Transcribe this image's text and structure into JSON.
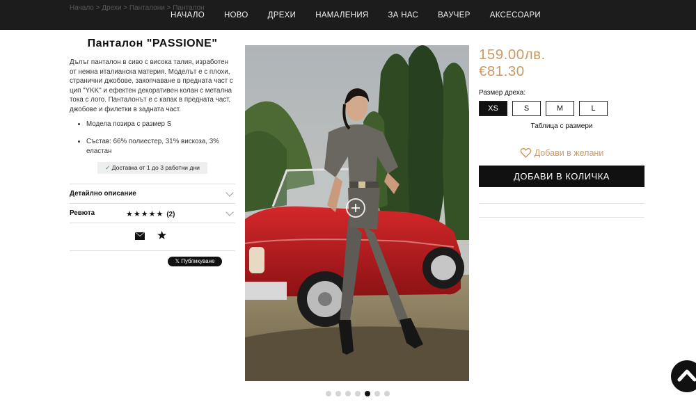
{
  "nav": {
    "ghost_text": "Начало > Дрехи > Панталони > Панталон",
    "items": [
      "НАЧАЛО",
      "НОВО",
      "ДРЕХИ",
      "НАМАЛЕНИЯ",
      "ЗА НАС",
      "ВАУЧЕР",
      "АКСЕСОАРИ"
    ]
  },
  "product": {
    "title": "Панталон \"PASSIONE\"",
    "description": "Дълъг панталон в сиво с висока талия, изработен от нежна италианска материя. Моделът е с плохи, странични джобове, закопчаване в предната част с цип \"YKK\" и ефектен декоративен колан с метална тока с лого. Панталонът е с капак в предната част, джобове и филетки в задната част.",
    "bullets": [
      "Модела позира с размер S",
      "Състав: 66% полиестер, 31% вискоза, 3% еластан"
    ],
    "delivery_check": "✓",
    "delivery": "Доставка от 1 до 3 работни дни"
  },
  "accordion": {
    "details_label": "Детайлно описание",
    "reviews_label": "Ревюта",
    "stars": "★★★★★",
    "reviews_count": "(2)"
  },
  "share": {
    "tweet_label": "𝕏 Публикуване",
    "icons": [
      "mail-icon",
      "star-icon"
    ]
  },
  "gallery": {
    "dots": 7,
    "active_dot": 5
  },
  "pricing": {
    "bgn": "159.00лв.",
    "eur": "€81.30",
    "color": "#c99a63"
  },
  "sizes": {
    "label": "Размер дреха:",
    "options": [
      "XS",
      "S",
      "M",
      "L"
    ],
    "selected": "XS",
    "table_link": "Таблица с размери"
  },
  "actions": {
    "wishlist": "Добави в желани",
    "add_to_cart": "ДОБАВИ В КОЛИЧКА"
  }
}
